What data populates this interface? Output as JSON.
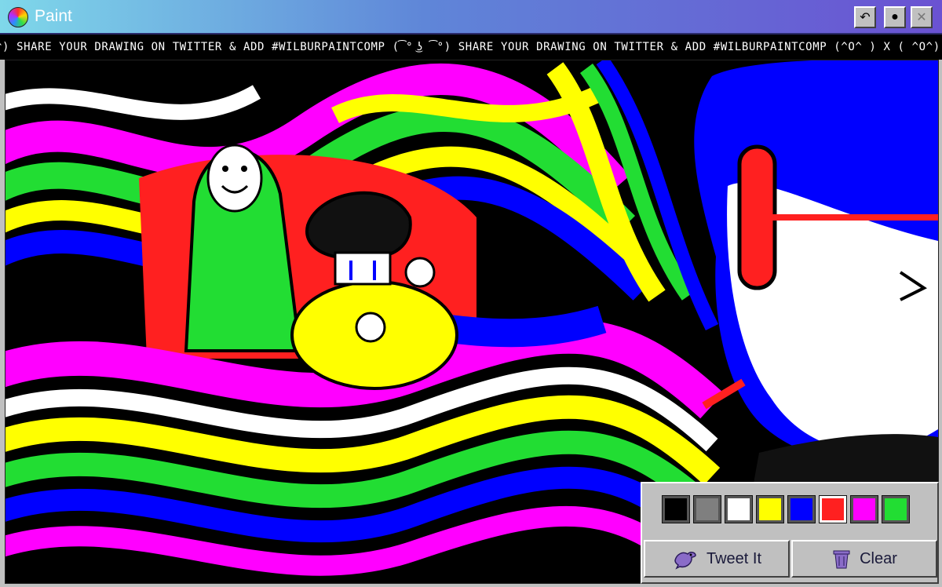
{
  "window": {
    "title": "Paint",
    "buttons": [
      {
        "name": "undo",
        "glyph": "↶"
      },
      {
        "name": "brush",
        "glyph": "●"
      },
      {
        "name": "close",
        "glyph": "✕"
      }
    ]
  },
  "ticker": {
    "text": "^) SHARE YOUR DRAWING ON TWITTER & ADD #WILBURPAINTCOMP (͡° ͜ʖ ͡°) SHARE YOUR DRAWING ON TWITTER & ADD #WILBURPAINTCOMP (^O^ ) X ( ^O^) SHARE"
  },
  "palette": {
    "colors": [
      "#000000",
      "#7f7f7f",
      "#ffffff",
      "#ffff00",
      "#0000ff",
      "#ff2020",
      "#ff00ff",
      "#22dd33"
    ],
    "selected_color": "#ff2020"
  },
  "actions": {
    "tweet_label": "Tweet It",
    "clear_label": "Clear"
  }
}
